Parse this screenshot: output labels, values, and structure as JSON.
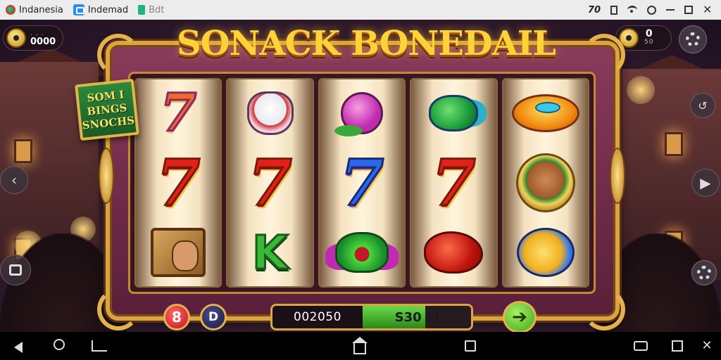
{
  "status_bar": {
    "app1": "Indanesia",
    "app2": "Indemad",
    "app3": "Bdt",
    "clock": "70"
  },
  "hud": {
    "coin_left": {
      "sub": ". . .",
      "value": "0000"
    },
    "coin_right": {
      "value": "0",
      "sub": "50"
    }
  },
  "title": "SONACK BONEDAIL",
  "sign": {
    "lines": [
      "SOM I",
      "BINGS",
      "SNOCHS"
    ]
  },
  "reels": [
    [
      "seven-rainbow",
      "seven-red",
      "treasure-box"
    ],
    [
      "clown-face",
      "seven-red",
      "letter-k"
    ],
    [
      "magenta-fruit",
      "seven-blue",
      "green-monster"
    ],
    [
      "green-gem",
      "seven-red",
      "red-bell"
    ],
    [
      "golden-disc",
      "dog-coin",
      "gold-scroll"
    ]
  ],
  "symbol_text": {
    "seven": "7",
    "k": "K"
  },
  "controls": {
    "red_button": "8",
    "navy_button": "D",
    "bet_left": "002050",
    "bet_right": "S30 El",
    "bet_fill_fraction": 0.58,
    "spin_icon": "➔"
  },
  "side": {
    "left_arrow": "‹",
    "right_arrow": "▶",
    "top_right_icon": "↺"
  },
  "colors": {
    "frame_gold": "#d9a441",
    "title_gold": "#ffd23a",
    "frame_purple": "#8a3b5a",
    "bet_green": "#4ac83a"
  },
  "icons": [
    "coin-icon",
    "gear-icon",
    "chest-icon",
    "back-icon",
    "home-icon",
    "apps-icon",
    "share-icon",
    "chat-icon",
    "square-icon",
    "close-icon"
  ]
}
